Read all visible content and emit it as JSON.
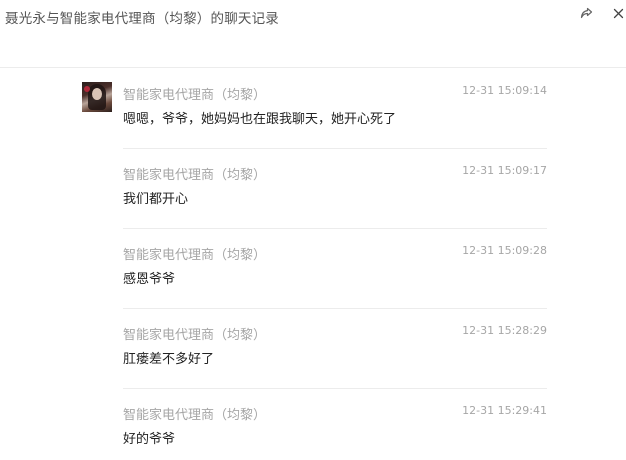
{
  "window": {
    "title": "聂光永与智能家电代理商（均黎）的聊天记录",
    "share_icon": "share-forward-icon",
    "close_icon": "close-icon"
  },
  "messages": [
    {
      "sender": "智能家电代理商（均黎）",
      "time": "12-31 15:09:14",
      "text": " 嗯嗯，爷爷，她妈妈也在跟我聊天，她开心死了",
      "has_avatar": true
    },
    {
      "sender": "智能家电代理商（均黎）",
      "time": "12-31 15:09:17",
      "text": "我们都开心",
      "has_avatar": false
    },
    {
      "sender": "智能家电代理商（均黎）",
      "time": "12-31 15:09:28",
      "text": "感恩爷爷",
      "has_avatar": false
    },
    {
      "sender": "智能家电代理商（均黎）",
      "time": "12-31 15:28:29",
      "text": "肛瘘差不多好了",
      "has_avatar": false
    },
    {
      "sender": "智能家电代理商（均黎）",
      "time": "12-31 15:29:41",
      "text": "好的爷爷",
      "has_avatar": false
    }
  ]
}
